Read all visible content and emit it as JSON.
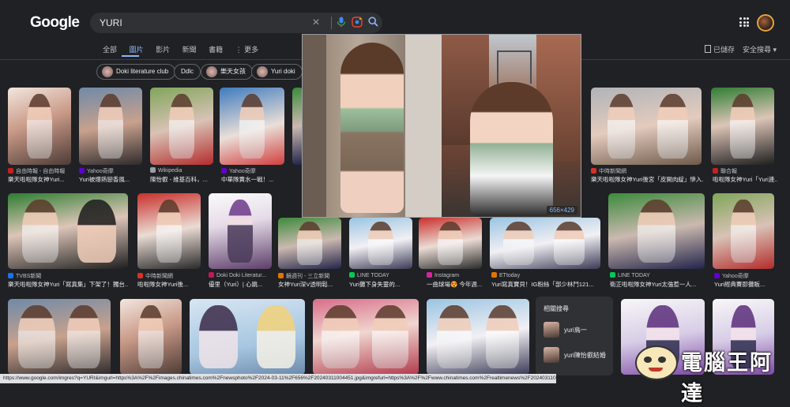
{
  "header": {
    "logo": "Google",
    "search_value": "YURI",
    "clear_icon": "×",
    "mic_icon": "🎤",
    "lens_icon": "◉",
    "search_icon": "⌕"
  },
  "tabs": [
    {
      "label": "全部"
    },
    {
      "label": "圖片",
      "active": true
    },
    {
      "label": "影片"
    },
    {
      "label": "新聞"
    },
    {
      "label": "書籍"
    },
    {
      "label": "⋮ 更多"
    }
  ],
  "toolbar": {
    "saved_label": "已儲存",
    "safe_search_label": "安全搜尋 ▾"
  },
  "chips": [
    {
      "label": "Doki literature club"
    },
    {
      "label": "Ddlc"
    },
    {
      "label": "樂天女孩"
    },
    {
      "label": "Yuri doki"
    }
  ],
  "results_row1": [
    {
      "source": "自由時報 - 自由時報",
      "caption": "樂天啦啦隊女神Yuri...",
      "source_color": "#c5221f"
    },
    {
      "source": "Yahoo奇摩",
      "caption": "Yuri被爆熱戀香風...",
      "source_color": "#6001d2"
    },
    {
      "source": "Wikipedia",
      "caption": "陳怡叡 - 維基百科，...",
      "source_color": "#9aa0a6"
    },
    {
      "source": "Yahoo奇摩",
      "caption": "中華隊賣水一戰！...",
      "source_color": "#6001d2"
    },
    {
      "source": "中時新聞網",
      "caption": "樂天啦啦隊女神Yuri後宮「皮開肉綻」慘入...",
      "source_color": "#d93025"
    },
    {
      "source": "聯合報",
      "caption": "啦啦隊女神Yuri「Yuri連...",
      "source_color": "#c5221f"
    }
  ],
  "results_row2": [
    {
      "source": "TVBS新聞",
      "caption": "樂天啦啦隊女神Yuri「寫真集」下架了！獨台...",
      "source_color": "#1a73e8"
    },
    {
      "source": "中時新聞網",
      "caption": "啦啦隊女神Yuri後...",
      "source_color": "#d93025"
    },
    {
      "source": "Doki Doki Literatur...",
      "caption": "優里（Yuri）| 心跳...",
      "source_color": "#c2185b"
    },
    {
      "source": "鏡週刊 - 三立新聞",
      "caption": "女神Yuri深V透明鬆...",
      "source_color": "#e37400"
    },
    {
      "source": "LINE TODAY",
      "caption": "Yuri攤下身失靈的...",
      "source_color": "#06c755"
    },
    {
      "source": "Instagram",
      "caption": "一曲球場😍 今年週...",
      "source_color": "#d6249f"
    },
    {
      "source": "ETtoday",
      "caption": "Yuri寫真寶貝！IG粉絲「部少林鬥121...",
      "source_color": "#e37400"
    },
    {
      "source": "LINE TODAY",
      "caption": "衛正啦啦隊女神Yuri太強惹一人...",
      "source_color": "#06c755"
    },
    {
      "source": "Yahoo奇摩",
      "caption": "Yuri經典賽即攤販...",
      "source_color": "#6001d2"
    }
  ],
  "preview": {
    "size_label": "656×429"
  },
  "related": {
    "heading": "相關搜尋",
    "items": [
      {
        "label": "yuri鳥一"
      },
      {
        "label": "yuri陳怡叡結婚"
      }
    ]
  },
  "status_bar": "https://www.google.com/imgres?q=YURI&imgurl=https%3A%2F%2Fimages.chinatimes.com%2Fnewsphoto%2F2024-03-11%2F656%2F20240311004451.jpg&imgrefurl=https%3A%2F%2Fwww.chinatimes.com%2Frealtimenews%2F20240311004424-260404&docid=ICayHF_bs5breMl&tbnid=9AMmJmguoLp6M&vet=12ahUKEwiE563cSJGGAxVCUHI",
  "watermark": {
    "text": "電腦王阿達"
  }
}
